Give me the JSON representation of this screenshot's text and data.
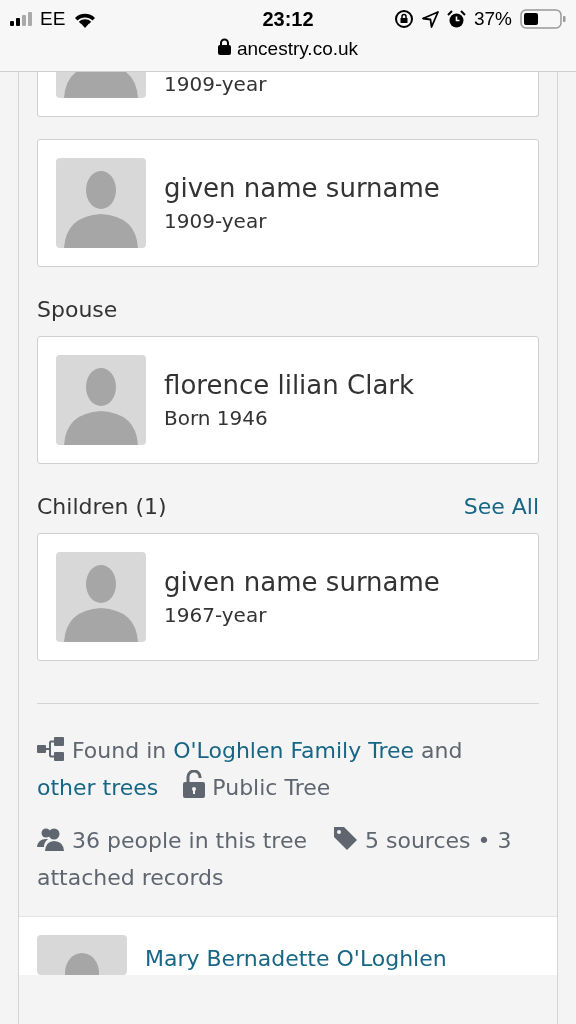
{
  "status_bar": {
    "carrier": "EE",
    "time": "23:12",
    "battery": "37%"
  },
  "url_bar": {
    "address": "ancestry.co.uk"
  },
  "sections": [
    {
      "people": [
        {
          "dates": "1909-year",
          "cut": true
        },
        {
          "name": "given name surname",
          "dates": "1909-year",
          "cut": false
        }
      ]
    },
    {
      "heading": "Spouse",
      "people": [
        {
          "name": "florence lilian Clark",
          "dates": "Born 1946",
          "cut": false
        }
      ]
    },
    {
      "heading": "Children (1)",
      "see_all": "See All",
      "people": [
        {
          "name": "given name surname",
          "dates": "1967-year",
          "cut": false
        }
      ]
    }
  ],
  "tree_info": {
    "found_in": "Found in",
    "tree_link": "O'Loghlen Family Tree",
    "and": "and",
    "other_link": "other trees",
    "visibility": "Public Tree",
    "people_count": "36 people in this tree",
    "sources": "5 sources • 3 attached records"
  },
  "next_result": {
    "name": "Mary Bernadette O'Loghlen"
  }
}
